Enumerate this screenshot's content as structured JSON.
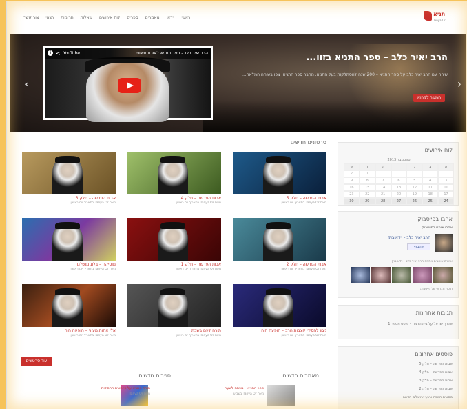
{
  "nav": [
    "ראשי",
    "וידאו",
    "מאמרים",
    "ספרים",
    "לוח אירועים",
    "שאלות",
    "תרומות",
    "תנאי",
    "צור קשר"
  ],
  "logo": {
    "title": "תניא",
    "subtitle": "Tanya Or"
  },
  "slider": {
    "video_title": "הרב יאיר כלב - ספר התניא לאורח חיצוני",
    "youtube": "YouTube",
    "title": "הרב יאיר כלב – ספר התניא בזוו...",
    "text": "שיחה עם הרב יאיר כלב על ספר התניא – 200 שנה להסתלקות בעל התניא. מחבר ספר התניא. צפו בשיחה המלאה...",
    "button": "המשך לקרוא"
  },
  "main": {
    "title": "סרטונים חדשים",
    "cards": [
      {
        "title": "אבות הפרשה – חלק 3",
        "meta": "מאת Tanya Or בתאריך יום ראשון"
      },
      {
        "title": "אבות הפרשה – חלק 4",
        "meta": "מאת Tanya Or בתאריך יום ראשון"
      },
      {
        "title": "אבות הפרשה – חלק 5",
        "meta": "מאת Tanya Or בתאריך יום ראשון"
      },
      {
        "title": "מוסיקה – בלוג מושלם",
        "meta": "מאת Tanya Or בתאריך יום ראשון"
      },
      {
        "title": "אבות הפרשה – חלק 1",
        "meta": "מאת Tanya Or בתאריך יום ראשון"
      },
      {
        "title": "אבות הפרשה – חלק 2",
        "meta": "מאת Tanya Or בתאריך יום ראשון"
      },
      {
        "title": "אלי אחות מעוף – הופעה חיה",
        "meta": "מאת Tanya Or בתאריך יום ראשון"
      },
      {
        "title": "תורה לעם בשבת",
        "meta": "מאת Tanya Or בתאריך יום ראשון"
      },
      {
        "title": "ניגון לחסידי קצבות הרב – הופעה חיה",
        "meta": "מאת Tanya Or בתאריך יום ראשון"
      }
    ],
    "more": "עוד סרטונים"
  },
  "sidebar": {
    "calendar_title": "לוח אירועים",
    "calendar_month": "ספטמבר 2013",
    "days": [
      "א",
      "ב",
      "ג",
      "ד",
      "ה",
      "ו",
      "ש"
    ],
    "weeks": [
      [
        "",
        "",
        "",
        "",
        "",
        "1",
        "2"
      ],
      [
        "3",
        "4",
        "5",
        "6",
        "7",
        "8",
        "9"
      ],
      [
        "10",
        "11",
        "12",
        "13",
        "14",
        "15",
        "16"
      ],
      [
        "17",
        "18",
        "19",
        "20",
        "21",
        "22",
        "23"
      ],
      [
        "24",
        "25",
        "26",
        "27",
        "28",
        "29",
        "30"
      ]
    ],
    "facebook_title": "אהבו בפייסבוק",
    "facebook_sub": "אהבו אותנו בפייסבוק",
    "fb_name": "הרב יאיר כלב - וידאובוק",
    "fb_like": "אהבתי",
    "fb_text": "אנשים אוהבים את זה הרב יאיר כלב - וידאובוק",
    "fb_plugin": "תוסף חברתי של פייסבוק",
    "comments_title": "תגובות אחרונות",
    "comments": [
      "אהרך ישראל על בית הרמה – פוסט מספר 1"
    ],
    "posts_title": "פוסטים אחרונים",
    "posts": [
      "אבות הפרשה – חלק 5",
      "אבות הפרשה – חלק 4",
      "אבות הפרשה – חלק 3",
      "אבות הפרשה – חלק 2",
      "מסורת חנוכה ורגעי ירושלים חדשה"
    ]
  },
  "bottom": {
    "articles_title": "מאמרים חדשים",
    "books_title": "ספרים חדשים",
    "article": "ספר התניא – מפתח לשער",
    "article_meta": "מאת Tanya Or בשבוע",
    "book": "תורת התניא על פי תורת החסידות",
    "book_meta": "מאת Tanya Or"
  }
}
